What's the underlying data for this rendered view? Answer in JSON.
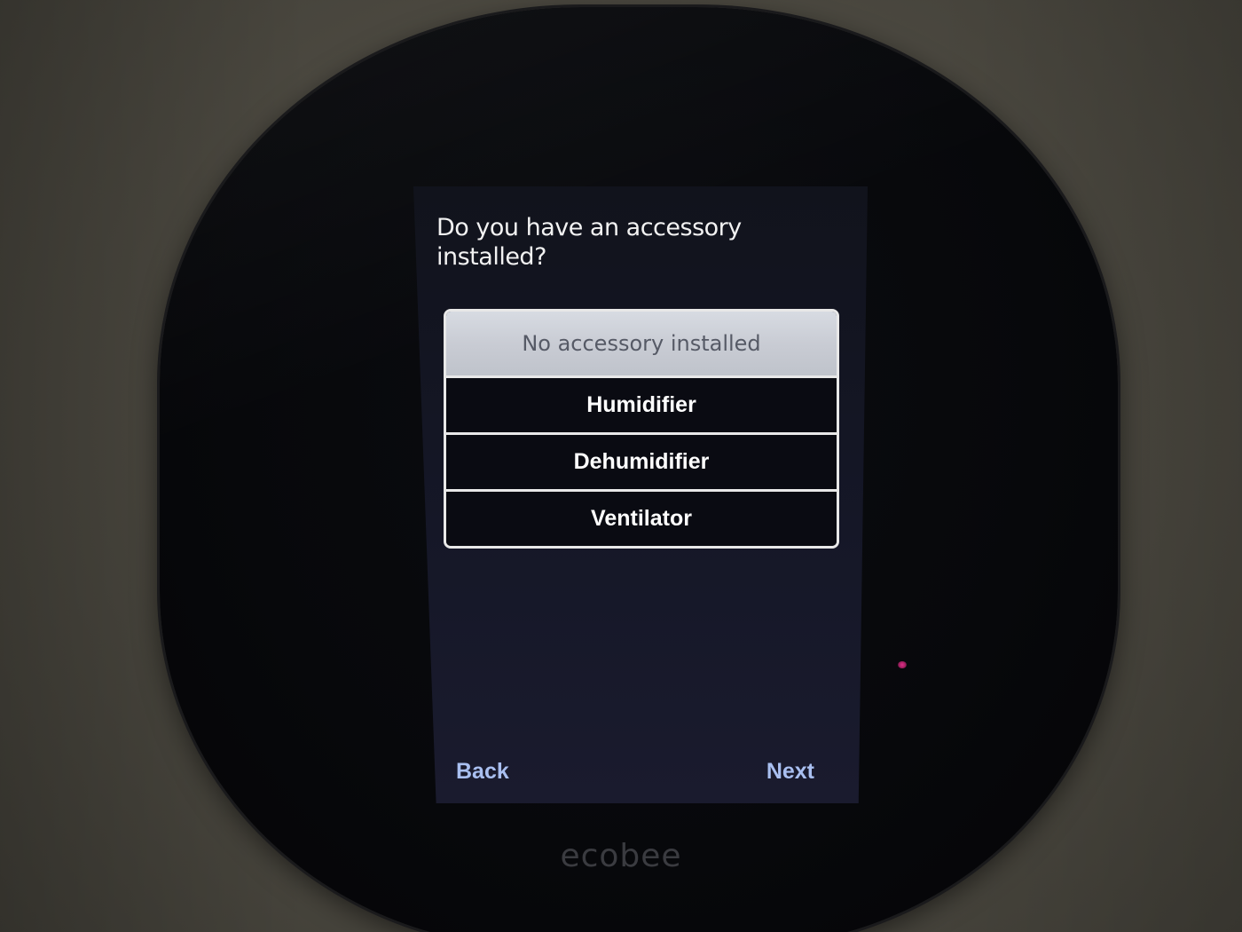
{
  "screen": {
    "question": "Do you have an accessory installed?",
    "options": [
      {
        "label": "No accessory installed",
        "selected": true
      },
      {
        "label": "Humidifier",
        "selected": false
      },
      {
        "label": "Dehumidifier",
        "selected": false
      },
      {
        "label": "Ventilator",
        "selected": false
      }
    ],
    "back_label": "Back",
    "next_label": "Next"
  },
  "device": {
    "brand": "ecobee",
    "accent_color": "#a9bff0",
    "indicator_color": "#e0308a"
  }
}
